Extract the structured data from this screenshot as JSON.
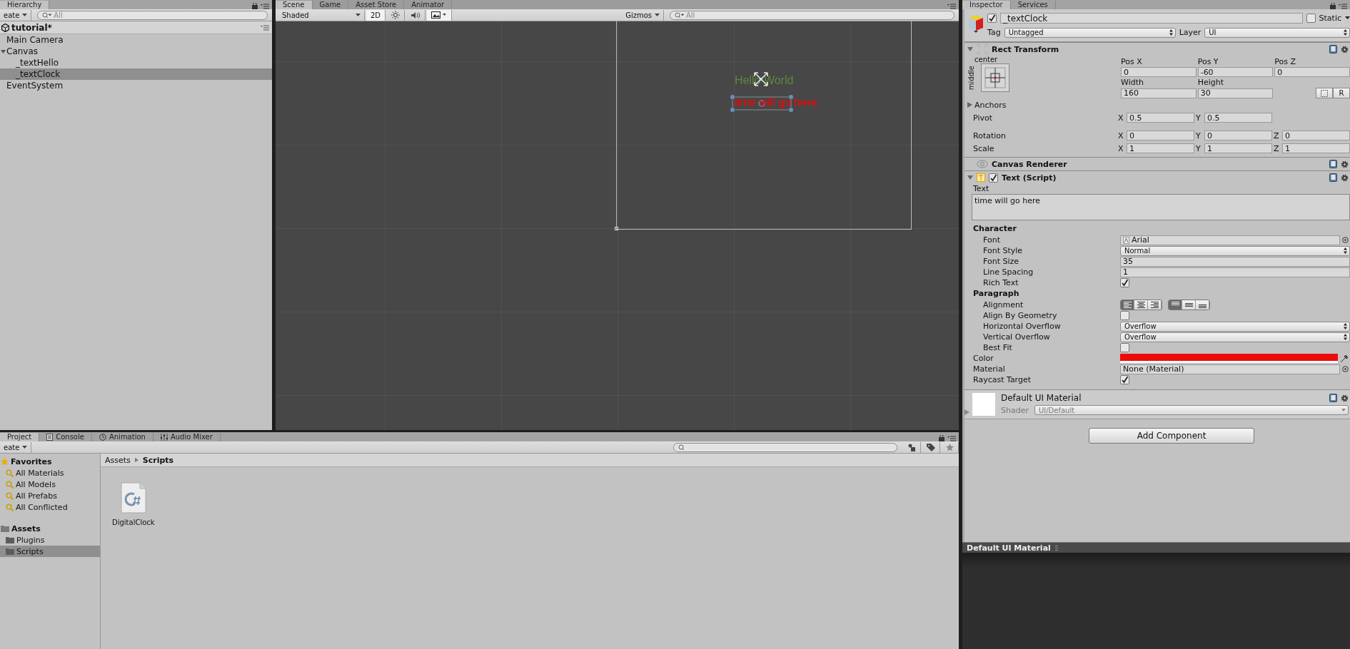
{
  "hierarchy": {
    "tab": {
      "label": "Hierarchy",
      "selected": true
    },
    "create": "eate",
    "search_placeholder": "All",
    "scene": "tutorial*",
    "items": [
      {
        "label": "Main Camera",
        "selected": false
      },
      {
        "label": "Canvas",
        "selected": false,
        "expanded": true,
        "children": [
          {
            "label": "_textHello",
            "selected": false
          },
          {
            "label": "_textClock",
            "selected": true
          }
        ]
      },
      {
        "label": "EventSystem",
        "selected": false
      }
    ]
  },
  "scene_view": {
    "tabs": [
      {
        "label": "Scene",
        "selected": true
      },
      {
        "label": "Game",
        "selected": false
      },
      {
        "label": "Asset Store",
        "selected": false
      },
      {
        "label": "Animator",
        "selected": false
      }
    ],
    "shading": "Shaded",
    "mode_2d": {
      "label": "2D",
      "on": true
    },
    "gizmos": "Gizmos",
    "search_placeholder": "All",
    "canvas_texts": [
      {
        "text": "Hello World",
        "color": "#5b8a3c",
        "selected": false
      },
      {
        "text": "time will go here",
        "color": "#ff0000",
        "selected": true
      }
    ]
  },
  "project": {
    "tabs": [
      {
        "label": "Project",
        "selected": true
      },
      {
        "label": "Console",
        "selected": false
      },
      {
        "label": "Animation",
        "selected": false
      },
      {
        "label": "Audio Mixer",
        "selected": false
      }
    ],
    "create": "eate",
    "favorites": {
      "label": "Favorites",
      "items": [
        "All Materials",
        "All Models",
        "All Prefabs",
        "All Conflicted"
      ]
    },
    "assets": {
      "label": "Assets",
      "children": [
        {
          "label": "Plugins",
          "selected": false
        },
        {
          "label": "Scripts",
          "selected": true
        }
      ]
    },
    "breadcrumb": [
      "Assets",
      "Scripts"
    ],
    "files": [
      {
        "name": "DigitalClock",
        "kind": "csharp"
      }
    ]
  },
  "inspector": {
    "tabs": [
      {
        "label": "Inspector",
        "selected": true
      },
      {
        "label": "Services",
        "selected": false
      }
    ],
    "object": {
      "active": true,
      "name": "_textClock",
      "static": {
        "label": "Static",
        "checked": false
      },
      "tag_label": "Tag",
      "tag": "Untagged",
      "layer_label": "Layer",
      "layer": "UI"
    },
    "rect_transform": {
      "title": "Rect Transform",
      "expanded": true,
      "anchor_h": "center",
      "anchor_v": "middle",
      "pos": [
        {
          "label": "Pos X",
          "value": "0"
        },
        {
          "label": "Pos Y",
          "value": "-60"
        },
        {
          "label": "Pos Z",
          "value": "0"
        }
      ],
      "size": [
        {
          "label": "Width",
          "value": "160"
        },
        {
          "label": "Height",
          "value": "30"
        }
      ],
      "raw_button": "R",
      "anchors": {
        "label": "Anchors",
        "expanded": false
      },
      "vectors": [
        {
          "label": "Pivot",
          "axes": [
            {
              "axis": "X",
              "value": "0.5"
            },
            {
              "axis": "Y",
              "value": "0.5"
            }
          ]
        },
        {
          "label": "Rotation",
          "axes": [
            {
              "axis": "X",
              "value": "0"
            },
            {
              "axis": "Y",
              "value": "0"
            },
            {
              "axis": "Z",
              "value": "0"
            }
          ]
        },
        {
          "label": "Scale",
          "axes": [
            {
              "axis": "X",
              "value": "1"
            },
            {
              "axis": "Y",
              "value": "1"
            },
            {
              "axis": "Z",
              "value": "1"
            }
          ]
        }
      ]
    },
    "canvas_renderer": {
      "title": "Canvas Renderer"
    },
    "text_component": {
      "title": "Text (Script)",
      "enabled": true,
      "expanded": true,
      "text_label": "Text",
      "text_value": "time will go here",
      "groups": [
        {
          "heading": "Character",
          "props": [
            {
              "label": "Font",
              "kind": "object",
              "value": "Arial",
              "asset_icon": true
            },
            {
              "label": "Font Style",
              "kind": "dropdown",
              "value": "Normal"
            },
            {
              "label": "Font Size",
              "kind": "field",
              "value": "35"
            },
            {
              "label": "Line Spacing",
              "kind": "field",
              "value": "1"
            },
            {
              "label": "Rich Text",
              "kind": "checkbox",
              "checked": true
            }
          ]
        },
        {
          "heading": "Paragraph",
          "props": [
            {
              "label": "Alignment",
              "kind": "alignment",
              "groups": [
                [
                  {
                    "selected": true
                  },
                  {
                    "selected": false
                  },
                  {
                    "selected": false
                  }
                ],
                [
                  {
                    "selected": true
                  },
                  {
                    "selected": false
                  },
                  {
                    "selected": false
                  }
                ]
              ]
            },
            {
              "label": "Align By Geometry",
              "kind": "checkbox",
              "checked": false
            },
            {
              "label": "Horizontal Overflow",
              "kind": "dropdown",
              "value": "Overflow"
            },
            {
              "label": "Vertical Overflow",
              "kind": "dropdown",
              "value": "Overflow"
            },
            {
              "label": "Best Fit",
              "kind": "checkbox",
              "checked": false
            }
          ]
        }
      ],
      "props": [
        {
          "label": "Color",
          "kind": "color",
          "color": "#ee0b0b"
        },
        {
          "label": "Material",
          "kind": "object",
          "value": "None (Material)",
          "asset_icon": false
        },
        {
          "label": "Raycast Target",
          "kind": "checkbox",
          "checked": true
        }
      ]
    },
    "material": {
      "name": "Default UI Material",
      "expanded": false,
      "shader_label": "Shader",
      "shader": "UI/Default"
    },
    "add_component": "Add Component",
    "preview": {
      "title": "Default UI Material"
    }
  }
}
